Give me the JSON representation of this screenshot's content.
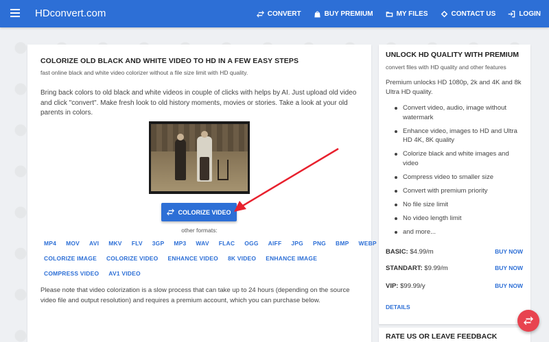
{
  "navbar": {
    "brand": "HDconvert.com",
    "items": [
      {
        "label": "CONVERT",
        "icon": "swap-icon"
      },
      {
        "label": "BUY PREMIUM",
        "icon": "bag-icon"
      },
      {
        "label": "MY FILES",
        "icon": "folder-icon"
      },
      {
        "label": "CONTACT US",
        "icon": "diamond-icon"
      },
      {
        "label": "LOGIN",
        "icon": "login-icon"
      }
    ]
  },
  "main": {
    "title": "COLORIZE OLD BLACK AND WHITE VIDEO TO HD IN A FEW EASY STEPS",
    "subtitle": "fast online black and white video colorizer without a file size limit with HD quality.",
    "description": "Bring back colors to old black and white videos in couple of clicks with helps by AI. Just upload old video and click \"convert\". Make fresh look to old history moments, movies or stories. Take a look at your old parents in colors.",
    "button_label": "COLORIZE VIDEO",
    "other_formats_label": "other formats:",
    "format_links": [
      "MP4",
      "MOV",
      "AVI",
      "MKV",
      "FLV",
      "3GP",
      "MP3",
      "WAV",
      "FLAC",
      "OGG",
      "AIFF",
      "JPG",
      "PNG",
      "BMP",
      "WEBP"
    ],
    "tool_links": [
      "COLORIZE IMAGE",
      "COLORIZE VIDEO",
      "ENHANCE VIDEO",
      "8K VIDEO",
      "ENHANCE IMAGE"
    ],
    "tool_links_2": [
      "COMPRESS VIDEO",
      "AV1 VIDEO"
    ],
    "note": "Please note that video colorization is a slow process that can take up to 24 hours (depending on the source video file and output resolution) and requires a premium account, which you can purchase below."
  },
  "premium": {
    "title": "UNLOCK HD QUALITY WITH PREMIUM",
    "subtitle": "convert files with HD quality and other features",
    "description": "Premium unlocks HD 1080p, 2k and 4K and 8k Ultra HD quality.",
    "features": [
      "Convert video, audio, image without watermark",
      "Enhance video, images to HD and Ultra HD 4K, 8K quality",
      "Colorize black and white images and video",
      "Compress video to smaller size",
      "Convert with premium priority",
      "No file size limit",
      "No video length limit",
      "and more..."
    ],
    "plans": [
      {
        "label": "BASIC:",
        "price": "$4.99/m",
        "action": "BUY NOW"
      },
      {
        "label": "STANDART:",
        "price": "$9.99/m",
        "action": "BUY NOW"
      },
      {
        "label": "VIP:",
        "price": "$99.99/y",
        "action": "BUY NOW"
      }
    ],
    "details_label": "DETAILS"
  },
  "feedback": {
    "title": "RATE US OR LEAVE FEEDBACK"
  },
  "colors": {
    "brand_blue": "#2d6fd6",
    "fab_red": "#e8434f",
    "annotation_red": "#e8212e"
  }
}
